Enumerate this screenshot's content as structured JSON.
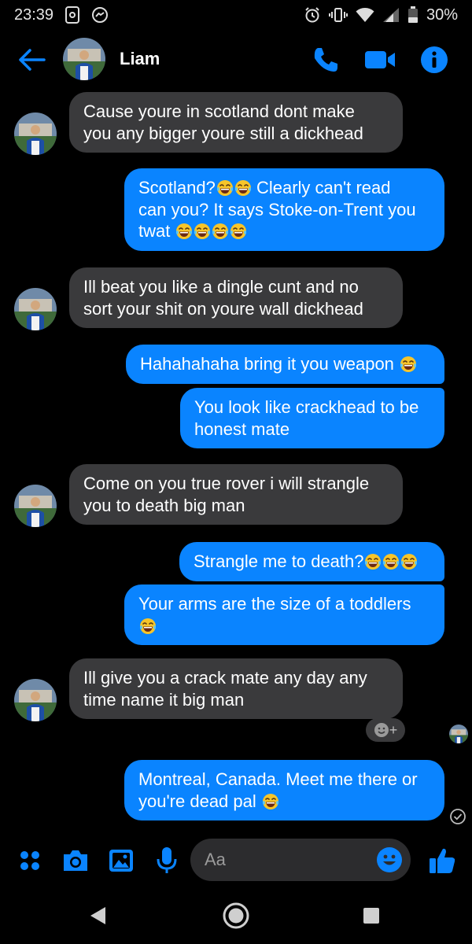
{
  "status_bar": {
    "time": "23:39",
    "battery": "30%"
  },
  "header": {
    "contact_name": "Liam"
  },
  "messages": [
    {
      "dir": "in",
      "lines": [
        "Cause youre in scotland dont make",
        "you any bigger youre still a dickhead"
      ]
    },
    {
      "dir": "out",
      "lines": [
        "Scotland?",
        " Clearly can't read",
        "can you? It says Stoke-on-Trent you",
        "twat "
      ]
    },
    {
      "dir": "in",
      "lines": [
        "Ill beat you like a dingle cunt and no",
        "sort your shit on youre wall dickhead"
      ]
    },
    {
      "dir": "out",
      "lines": [
        "Hahahahaha bring it you weapon "
      ]
    },
    {
      "dir": "out",
      "lines": [
        "You look like crackhead to be",
        "honest mate"
      ]
    },
    {
      "dir": "in",
      "lines": [
        "Come on you true rover i will strangle",
        "you to death big man"
      ]
    },
    {
      "dir": "out",
      "lines": [
        "Strangle me to death?"
      ]
    },
    {
      "dir": "out",
      "lines": [
        "Your arms are the size of a toddlers",
        ""
      ]
    },
    {
      "dir": "in",
      "lines": [
        "Ill give you a crack mate any day any",
        "time name it big man"
      ]
    },
    {
      "dir": "out",
      "lines": [
        "Montreal, Canada. Meet me there or",
        "you're dead pal "
      ]
    }
  ],
  "reaction_button": {
    "label": "+"
  },
  "composer": {
    "placeholder": "Aa"
  },
  "icons": {
    "back": "arrow-left-icon",
    "call": "phone-icon",
    "video": "video-camera-icon",
    "info": "info-icon",
    "menu": "four-dots-icon",
    "camera": "camera-icon",
    "gallery": "image-icon",
    "mic": "microphone-icon",
    "emoji": "smiley-icon",
    "like": "thumbs-up-icon",
    "laugh": "tears-of-joy-emoji"
  },
  "colors": {
    "accent": "#0a84ff",
    "incoming_bubble": "#3a3a3c",
    "background": "#000000"
  }
}
